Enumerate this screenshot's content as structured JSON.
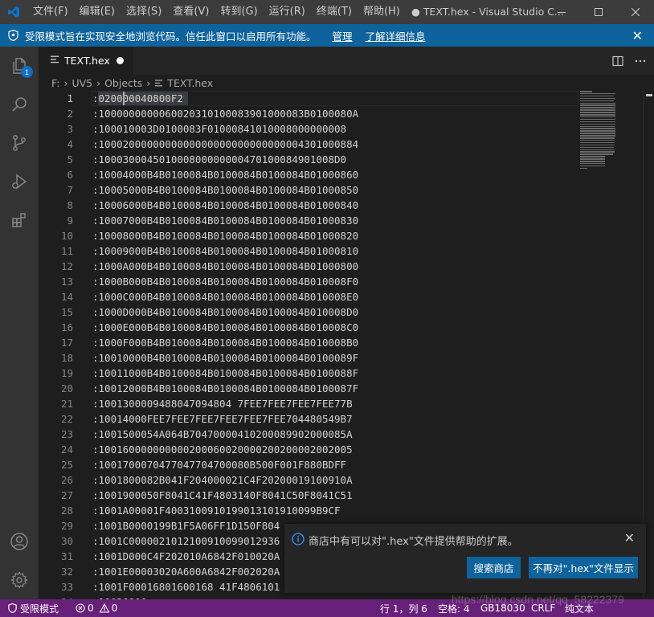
{
  "titlebar": {
    "menus": [
      "文件(F)",
      "编辑(E)",
      "选择(S)",
      "查看(V)",
      "转到(G)",
      "运行(R)",
      "终端(T)",
      "帮助(H)"
    ],
    "window_title": "● TEXT.hex - Visual Studio C...",
    "icons": [
      "vscode-logo",
      "minimize-icon",
      "maximize-icon",
      "close-icon"
    ]
  },
  "banner": {
    "message": "受限模式旨在实现安全地浏览代码。信任此窗口以启用所有功能。",
    "manage_link": "管理",
    "learn_more_link": "了解详细信息"
  },
  "activitybar": {
    "explorer_badge": "1",
    "icons": [
      "explorer-icon",
      "search-icon",
      "source-control-icon",
      "run-debug-icon",
      "extensions-icon",
      "account-icon",
      "settings-gear-icon"
    ]
  },
  "tab": {
    "filename": "TEXT.hex",
    "dirty": true
  },
  "breadcrumb": {
    "parts": [
      "F:",
      "UV5",
      "Objects",
      "TEXT.hex"
    ]
  },
  "editor": {
    "cursor_line": 1,
    "lines": [
      ":020000040800F2",
      ":1000000000060020310100083901000083B0100080A",
      ":100010003D0100083F01000841010008000000008",
      ":1000200000000000000000000000000004301000884",
      ":100030004501000800000000470100084901008D0",
      ":10004000B4B0100084B0100084B0100084B01000860",
      ":10005000B4B0100084B0100084B0100084B01000850",
      ":10006000B4B0100084B0100084B0100084B01000840",
      ":10007000B4B0100084B0100084B0100084B01000830",
      ":10008000B4B0100084B0100084B0100084B01000820",
      ":10009000B4B0100084B0100084B0100084B01000810",
      ":1000A000B4B0100084B0100084B0100084B01000800",
      ":1000B000B4B0100084B0100084B0100084B010008F0",
      ":1000C000B4B0100084B0100084B0100084B010008E0",
      ":1000D000B4B0100084B0100084B0100084B010008D0",
      ":1000E000B4B0100084B0100084B0100084B010008C0",
      ":1000F000B4B0100084B0100084B0100084B010008B0",
      ":10010000B4B0100084B0100084B0100084B0100089F",
      ":10011000B4B0100084B0100084B0100084B0100088F",
      ":10012000B4B0100084B0100084B0100084B0100087F",
      ":1001300009488047094804 7FEE7FEE7FEE7FEE77B",
      ":10014000FEE7FEE7FEE7FEE7FEE7FEE704480549B7",
      ":1001500054A064B70470000410200089902000085A",
      ":100160000000000200060020000200200002002005",
      ":1001700070477047704700080B500F001F880BDFF",
      ":1001800082B041F204000021C4F20200019100910A",
      ":1001900050F8041C41F4803140F8041C50F8041C51",
      ":1001A00001F4003100910199013101910099B9CF",
      ":1001B0000199B1F5A06FF1D150F804",
      ":1001C0000021012100910099012936",
      ":1001D000C4F202010A6842F010020A",
      ":1001E00003020A600A6842F002020A",
      ":1001F00016801600168 41F4806101",
      ":10020000"
    ]
  },
  "notification": {
    "message": "商店中有可以对\".hex\"文件提供帮助的扩展。",
    "search_button": "搜索商店",
    "dismiss_button": "不再对\".hex\"文件显示"
  },
  "statusbar": {
    "restricted": "受限模式",
    "errors": "0",
    "warnings": "0",
    "position": "行 1，列 6",
    "spaces": "空格: 4",
    "encoding": "GB18030",
    "eol": "CRLF",
    "language": "纯文本"
  },
  "watermark": "https://blog.csdn.net/qq_58222379"
}
